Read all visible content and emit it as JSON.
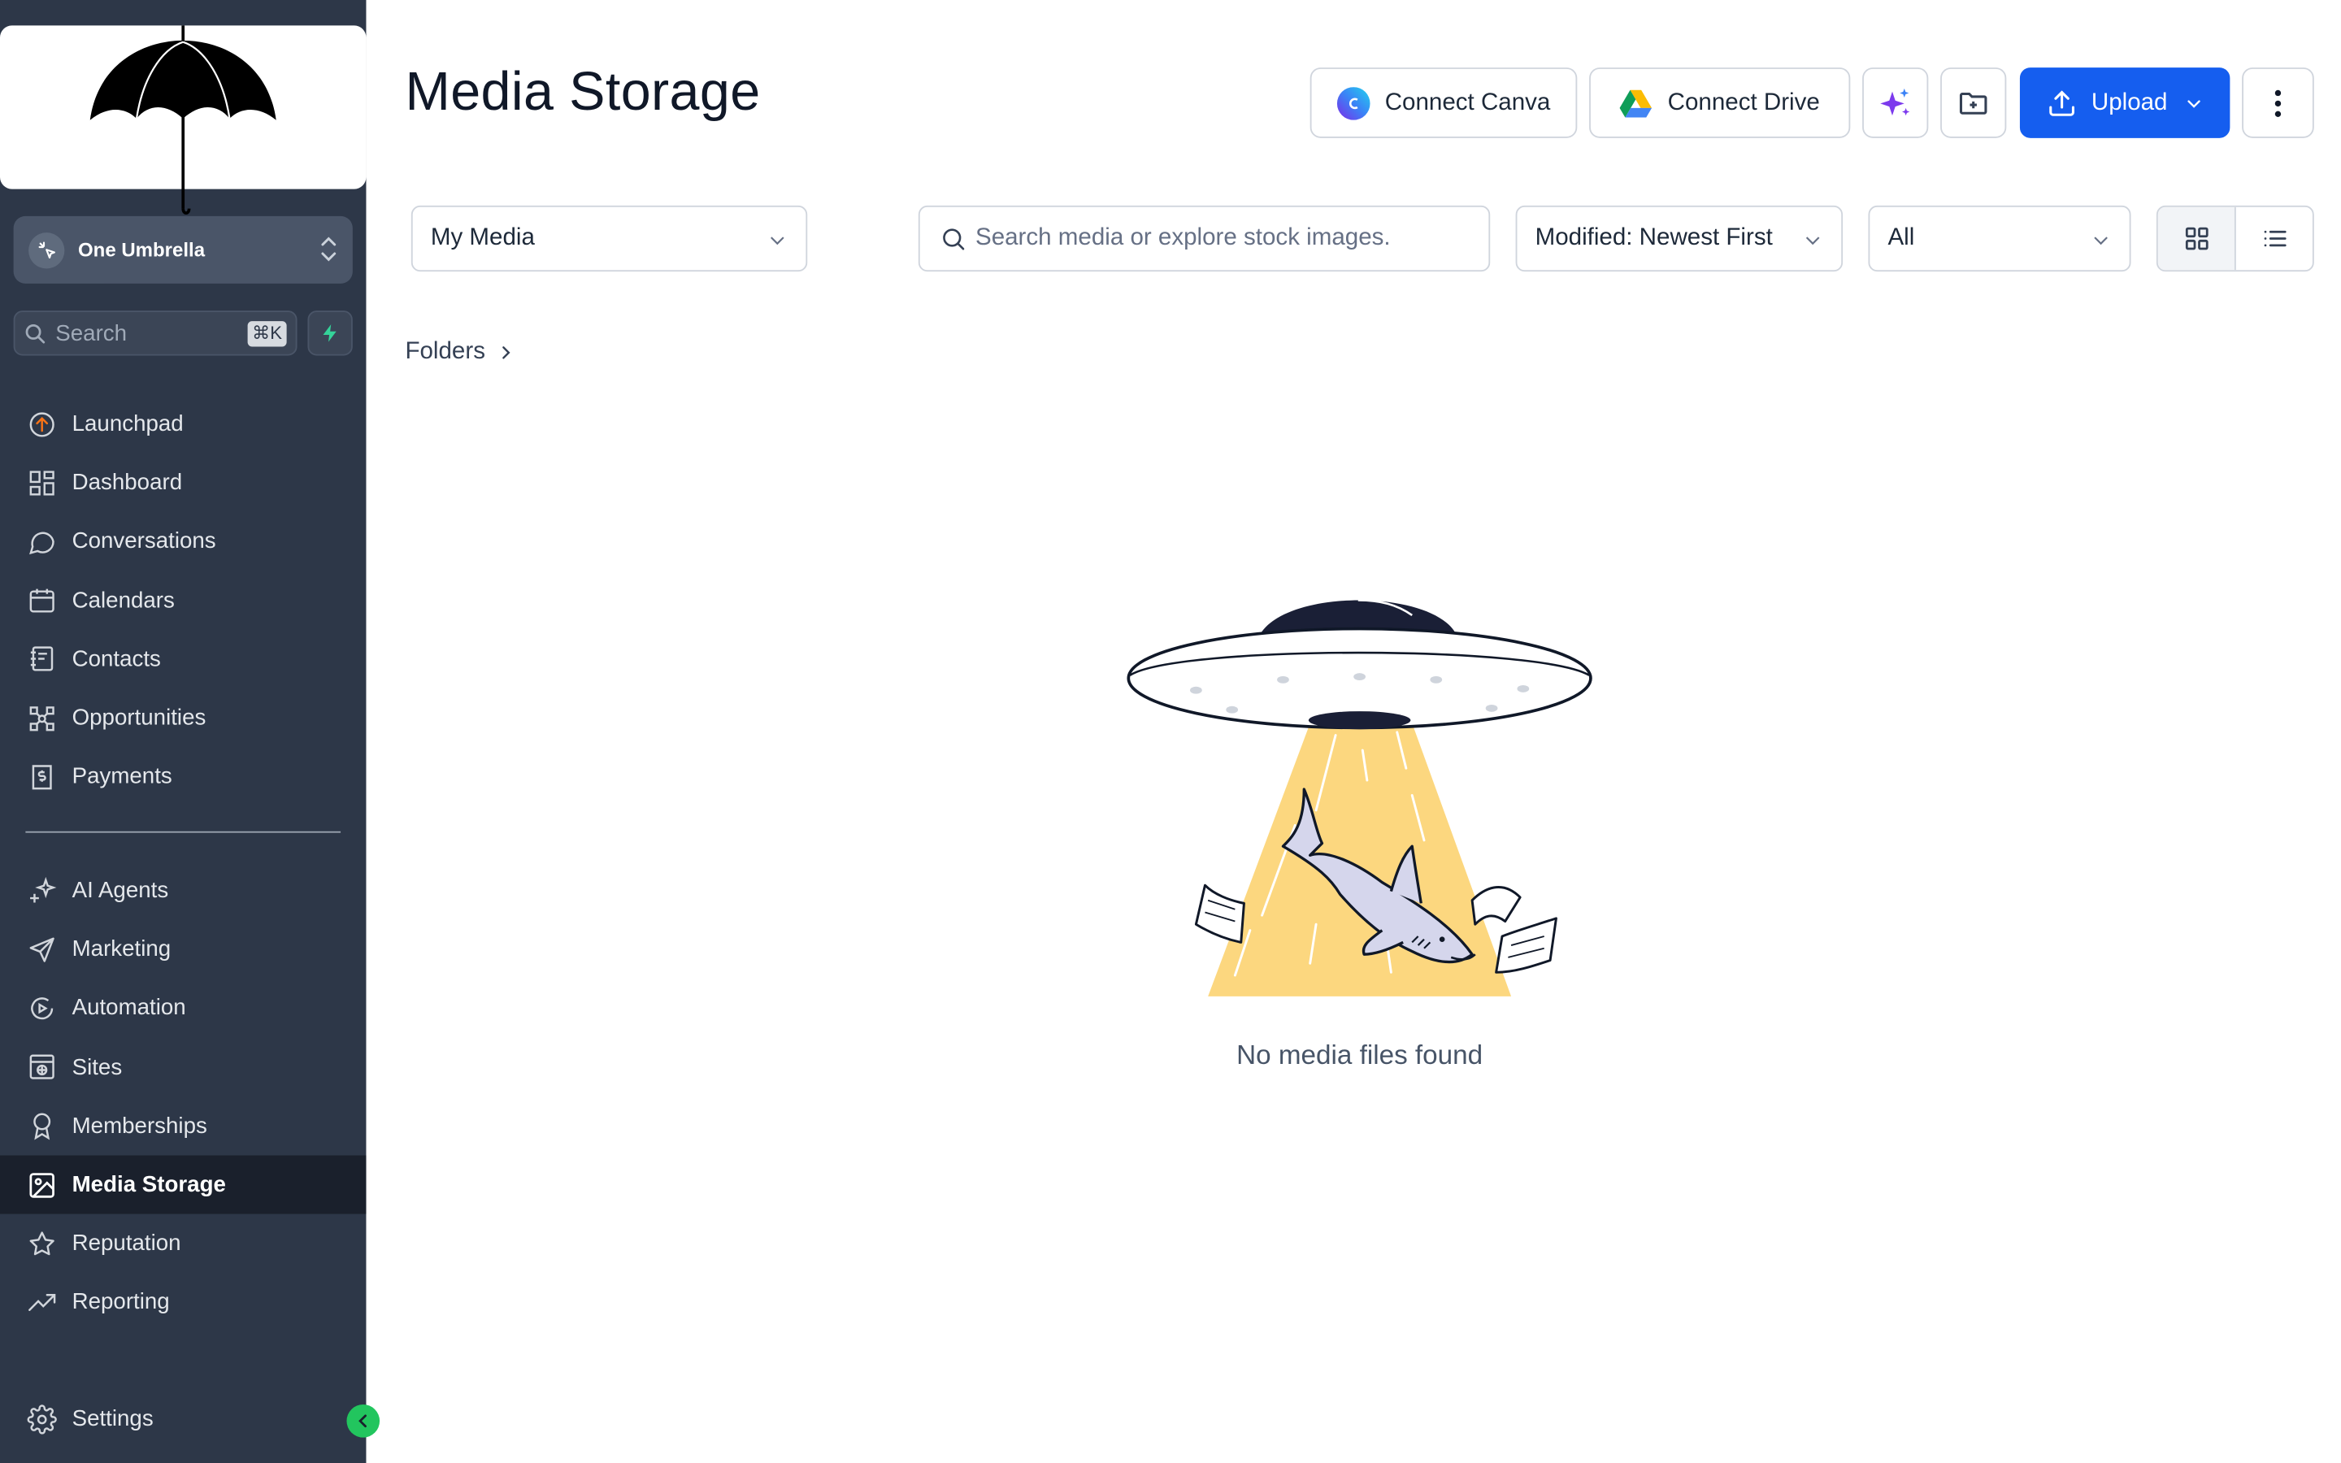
{
  "sidebar": {
    "account_name": "One Umbrella",
    "search_placeholder": "Search",
    "search_shortcut": "⌘K",
    "nav_top": [
      {
        "label": "Launchpad",
        "icon": "launchpad-icon"
      },
      {
        "label": "Dashboard",
        "icon": "dashboard-icon"
      },
      {
        "label": "Conversations",
        "icon": "chat-bubble-icon"
      },
      {
        "label": "Calendars",
        "icon": "calendar-icon"
      },
      {
        "label": "Contacts",
        "icon": "contacts-icon"
      },
      {
        "label": "Opportunities",
        "icon": "opportunities-icon"
      },
      {
        "label": "Payments",
        "icon": "payments-icon"
      }
    ],
    "nav_bottom": [
      {
        "label": "AI Agents",
        "icon": "sparkle-icon"
      },
      {
        "label": "Marketing",
        "icon": "send-icon"
      },
      {
        "label": "Automation",
        "icon": "automation-icon"
      },
      {
        "label": "Sites",
        "icon": "sites-icon"
      },
      {
        "label": "Memberships",
        "icon": "award-icon"
      },
      {
        "label": "Media Storage",
        "icon": "image-icon"
      },
      {
        "label": "Reputation",
        "icon": "star-icon"
      },
      {
        "label": "Reporting",
        "icon": "trending-icon"
      }
    ],
    "settings_label": "Settings"
  },
  "header": {
    "title": "Media Storage",
    "connect_canva": "Connect Canva",
    "connect_drive": "Connect Drive",
    "upload": "Upload",
    "accent_color": "#155eef"
  },
  "filters": {
    "media_source": "My Media",
    "search_placeholder": "Search media or explore stock images.",
    "sort": "Modified: Newest First",
    "type": "All"
  },
  "breadcrumb": {
    "folders": "Folders"
  },
  "empty_state": {
    "message": "No media files found"
  }
}
